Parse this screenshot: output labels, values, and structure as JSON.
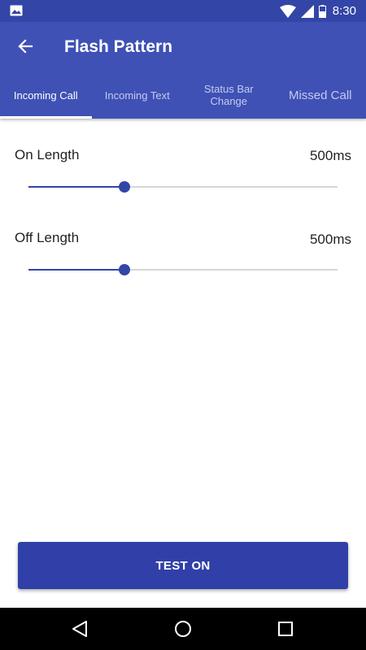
{
  "status_bar": {
    "time": "8:30",
    "icons": [
      "gallery-icon",
      "wifi-icon",
      "signal-icon",
      "battery-icon"
    ]
  },
  "app_bar": {
    "title": "Flash Pattern",
    "back_icon": "arrow-back-icon"
  },
  "tabs": [
    {
      "label": "Incoming Call",
      "active": true
    },
    {
      "label": "Incoming Text",
      "active": false
    },
    {
      "label": "Status Bar Change",
      "active": false
    },
    {
      "label": "Missed Call",
      "active": false
    }
  ],
  "settings": {
    "on_length": {
      "label": "On Length",
      "value": "500ms",
      "slider_fraction": 0.31
    },
    "off_length": {
      "label": "Off Length",
      "value": "500ms",
      "slider_fraction": 0.31
    }
  },
  "test_button": {
    "label": "TEST ON"
  },
  "colors": {
    "primary": "#3f51b5",
    "primary_dark": "#3345a6",
    "accent": "#3040a8"
  },
  "nav_bar": {
    "icons": [
      "back-triangle-icon",
      "home-circle-icon",
      "recents-square-icon"
    ]
  }
}
